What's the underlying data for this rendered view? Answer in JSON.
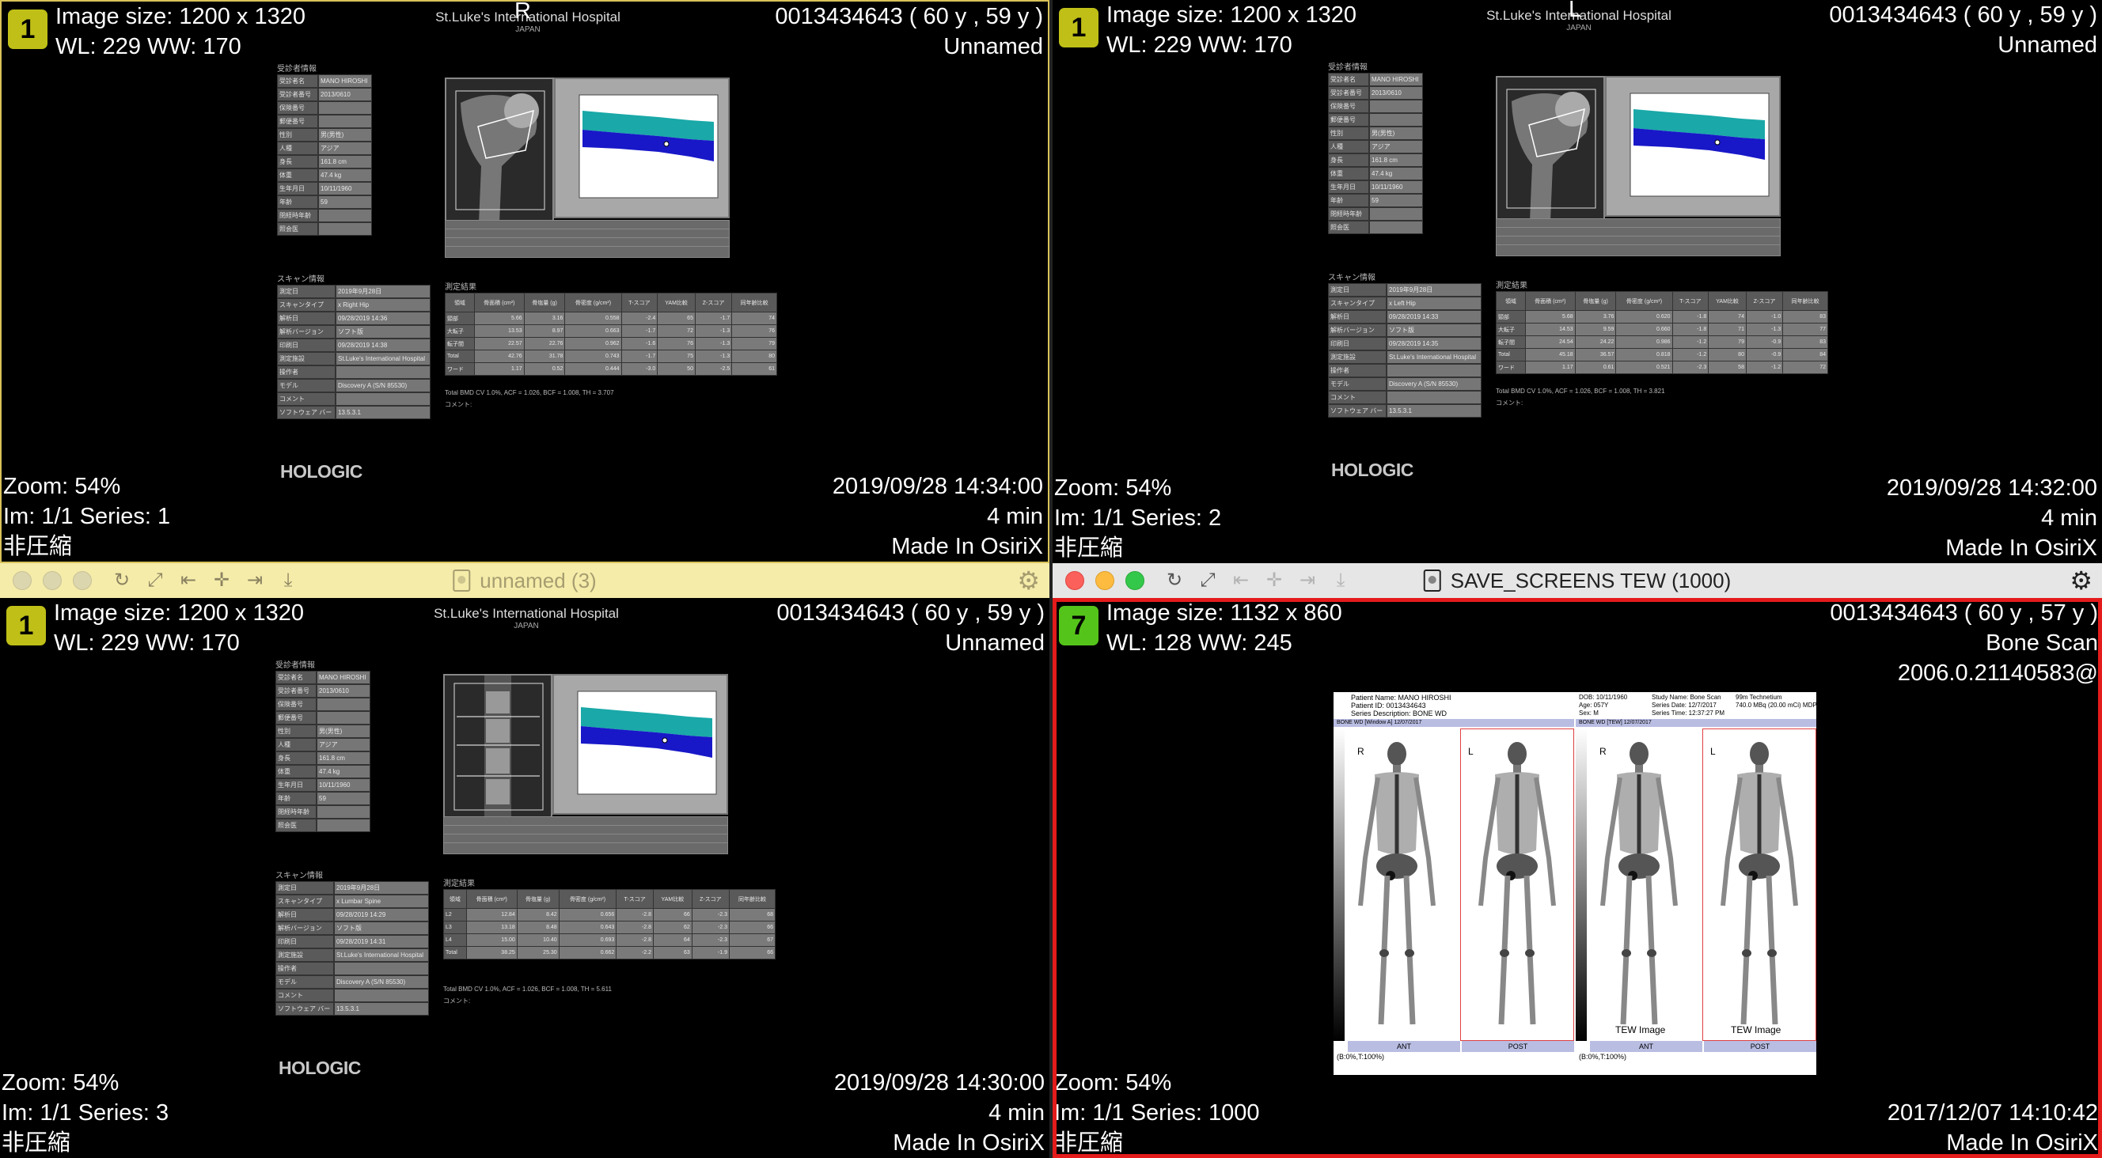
{
  "viewers": [
    {
      "badge": "1",
      "orient_left": "R",
      "orient_right": "",
      "info_tl": [
        "Image size: 1200 x 1320",
        "WL: 229 WW: 170"
      ],
      "info_tr": [
        "0013434643 (  60 y ,  59 y )",
        "Unnamed"
      ],
      "info_bl": [
        "Zoom: 54%",
        "Im: 1/1  Series:  1",
        "非圧縮"
      ],
      "info_br": [
        "2019/09/28 14:34:00",
        "4 min",
        "Made In OsiriX"
      ],
      "report": {
        "hospital": "St.Luke's International Hospital",
        "country": "JAPAN",
        "patient_section": "受診者情報",
        "patient_rows": [
          [
            "受診者名",
            "MANO HIROSHI"
          ],
          [
            "受診者番号",
            "2013/0610"
          ],
          [
            "保険番号",
            ""
          ],
          [
            "郵便番号",
            ""
          ],
          [
            "性別",
            "男(男性)"
          ],
          [
            "人種",
            "アジア"
          ],
          [
            "身長",
            "161.8 cm"
          ],
          [
            "体重",
            "47.4 kg"
          ],
          [
            "生年月日",
            "10/11/1960"
          ],
          [
            "年齢",
            "59"
          ],
          [
            "閉経時年齢",
            ""
          ],
          [
            "照会医",
            ""
          ]
        ],
        "scan_section": "スキャン情報",
        "scan_rows": [
          [
            "測定日",
            "2019年9月28日"
          ],
          [
            "スキャンタイプ",
            "x Right Hip"
          ],
          [
            "解析日",
            "09/28/2019 14:36"
          ],
          [
            "解析バージョン",
            "ソフト版"
          ],
          [
            "印刷日",
            "09/28/2019 14:38"
          ],
          [
            "測定施設",
            "St.Luke's International Hospital"
          ],
          [
            "操作者",
            ""
          ],
          [
            "モデル",
            "Discovery A (S/N 85530)"
          ],
          [
            "コメント",
            ""
          ],
          [
            "ソフトウェア バージョン",
            "13.5.3.1"
          ]
        ],
        "results_label": "測定結果",
        "results_header": [
          "領域",
          "骨面積 (cm²)",
          "骨塩量 (g)",
          "骨密度 (g/cm²)",
          "T-スコア",
          "YAM比較",
          "Z-スコア",
          "同年齢比較"
        ],
        "results_rows": [
          [
            "頸部",
            "5.66",
            "3.16",
            "0.558",
            "-2.4",
            "65",
            "-1.7",
            "74"
          ],
          [
            "大転子",
            "13.53",
            "8.97",
            "0.663",
            "-1.7",
            "72",
            "-1.3",
            "76"
          ],
          [
            "転子間",
            "22.57",
            "22.76",
            "0.962",
            "-1.6",
            "76",
            "-1.3",
            "79"
          ],
          [
            "Total",
            "42.76",
            "31.78",
            "0.743",
            "-1.7",
            "75",
            "-1.3",
            "80"
          ],
          [
            "ワード",
            "1.17",
            "0.52",
            "0.444",
            "-3.0",
            "50",
            "-2.5",
            "61"
          ]
        ],
        "footnote": "Total BMD CV 1.0%, ACF = 1.026, BCF = 1.008, TH = 3.707",
        "comment": "コメント:",
        "brand": "HOLOGIC"
      }
    },
    {
      "badge": "1",
      "orient_left": "",
      "orient_right": "L",
      "info_tl": [
        "Image size: 1200 x 1320",
        "WL: 229 WW: 170"
      ],
      "info_tr": [
        "0013434643 (  60 y ,  59 y )",
        "Unnamed"
      ],
      "info_bl": [
        "Zoom: 54%",
        "Im: 1/1  Series:  2",
        "非圧縮"
      ],
      "info_br": [
        "2019/09/28 14:32:00",
        "4 min",
        "Made In OsiriX"
      ],
      "report": {
        "hospital": "St.Luke's International Hospital",
        "country": "JAPAN",
        "patient_section": "受診者情報",
        "patient_rows": [
          [
            "受診者名",
            "MANO HIROSHI"
          ],
          [
            "受診者番号",
            "2013/0610"
          ],
          [
            "保険番号",
            ""
          ],
          [
            "郵便番号",
            ""
          ],
          [
            "性別",
            "男(男性)"
          ],
          [
            "人種",
            "アジア"
          ],
          [
            "身長",
            "161.8 cm"
          ],
          [
            "体重",
            "47.4 kg"
          ],
          [
            "生年月日",
            "10/11/1960"
          ],
          [
            "年齢",
            "59"
          ],
          [
            "閉経時年齢",
            ""
          ],
          [
            "照会医",
            ""
          ]
        ],
        "scan_section": "スキャン情報",
        "scan_rows": [
          [
            "測定日",
            "2019年9月28日"
          ],
          [
            "スキャンタイプ",
            "x Left Hip"
          ],
          [
            "解析日",
            "09/28/2019 14:33"
          ],
          [
            "解析バージョン",
            "ソフト版"
          ],
          [
            "印刷日",
            "09/28/2019 14:35"
          ],
          [
            "測定施設",
            "St.Luke's International Hospital"
          ],
          [
            "操作者",
            ""
          ],
          [
            "モデル",
            "Discovery A (S/N 85530)"
          ],
          [
            "コメント",
            ""
          ],
          [
            "ソフトウェア バージョン",
            "13.5.3.1"
          ]
        ],
        "results_label": "測定結果",
        "results_header": [
          "領域",
          "骨面積 (cm²)",
          "骨塩量 (g)",
          "骨密度 (g/cm²)",
          "T-スコア",
          "YAM比較",
          "Z-スコア",
          "同年齢比較"
        ],
        "results_rows": [
          [
            "頸部",
            "5.68",
            "3.76",
            "0.620",
            "-1.8",
            "74",
            "-1.0",
            "83"
          ],
          [
            "大転子",
            "14.53",
            "9.59",
            "0.660",
            "-1.8",
            "71",
            "-1.3",
            "77"
          ],
          [
            "転子間",
            "24.54",
            "24.22",
            "0.986",
            "-1.2",
            "79",
            "-0.9",
            "83"
          ],
          [
            "Total",
            "45.18",
            "36.57",
            "0.818",
            "-1.2",
            "80",
            "-0.9",
            "84"
          ],
          [
            "ワード",
            "1.17",
            "0.61",
            "0.521",
            "-2.3",
            "58",
            "-1.2",
            "72"
          ]
        ],
        "footnote": "Total BMD CV 1.0%, ACF = 1.026, BCF = 1.008, TH = 3.821",
        "comment": "コメント:",
        "brand": "HOLOGIC"
      }
    },
    {
      "badge": "1",
      "orient_left": "",
      "orient_right": "",
      "info_tl": [
        "Image size: 1200 x 1320",
        "WL: 229 WW: 170"
      ],
      "info_tr": [
        "0013434643 (  60 y ,  59 y )",
        "Unnamed"
      ],
      "info_bl": [
        "Zoom: 54%",
        "Im: 1/1  Series:  3",
        "非圧縮"
      ],
      "info_br": [
        "2019/09/28 14:30:00",
        "4 min",
        "Made In OsiriX"
      ],
      "report": {
        "hospital": "St.Luke's International Hospital",
        "country": "JAPAN",
        "patient_section": "受診者情報",
        "patient_rows": [
          [
            "受診者名",
            "MANO HIROSHI"
          ],
          [
            "受診者番号",
            "2013/0610"
          ],
          [
            "保険番号",
            ""
          ],
          [
            "郵便番号",
            ""
          ],
          [
            "性別",
            "男(男性)"
          ],
          [
            "人種",
            "アジア"
          ],
          [
            "身長",
            "161.8 cm"
          ],
          [
            "体重",
            "47.4 kg"
          ],
          [
            "生年月日",
            "10/11/1960"
          ],
          [
            "年齢",
            "59"
          ],
          [
            "閉経時年齢",
            ""
          ],
          [
            "照会医",
            ""
          ]
        ],
        "scan_section": "スキャン情報",
        "scan_rows": [
          [
            "測定日",
            "2019年9月28日"
          ],
          [
            "スキャンタイプ",
            "x Lumbar Spine"
          ],
          [
            "解析日",
            "09/28/2019 14:29"
          ],
          [
            "解析バージョン",
            "ソフト版"
          ],
          [
            "印刷日",
            "09/28/2019 14:31"
          ],
          [
            "測定施設",
            "St.Luke's International Hospital"
          ],
          [
            "操作者",
            ""
          ],
          [
            "モデル",
            "Discovery A (S/N 85530)"
          ],
          [
            "コメント",
            ""
          ],
          [
            "ソフトウェア バージョン",
            "13.5.3.1"
          ]
        ],
        "results_label": "測定結果",
        "results_header": [
          "領域",
          "骨面積 (cm²)",
          "骨塩量 (g)",
          "骨密度 (g/cm²)",
          "T-スコア",
          "YAM比較",
          "Z-スコア",
          "同年齢比較"
        ],
        "results_rows": [
          [
            "L2",
            "12.84",
            "8.42",
            "0.656",
            "-2.8",
            "66",
            "-2.3",
            "68"
          ],
          [
            "L3",
            "13.18",
            "8.48",
            "0.643",
            "-2.8",
            "62",
            "-2.3",
            "66"
          ],
          [
            "L4",
            "15.00",
            "10.40",
            "0.693",
            "-2.8",
            "64",
            "-2.3",
            "67"
          ],
          [
            "Total",
            "38.25",
            "25.30",
            "0.662",
            "-2.2",
            "63",
            "-1.9",
            "66"
          ]
        ],
        "footnote": "Total BMD CV 1.0%, ACF = 1.026, BCF = 1.008, TH = 5.611",
        "comment": "コメント:",
        "brand": "HOLOGIC"
      }
    },
    {
      "badge": "7",
      "orient_left": "",
      "orient_right": "",
      "info_tl": [
        "Image size: 1132 x 860",
        "WL: 128 WW: 245"
      ],
      "info_tr": [
        "0013434643 (  60 y ,  57 y )",
        "Bone Scan",
        "2006.0.21140583@"
      ],
      "info_bl": [
        "Zoom: 54%",
        "Im: 1/1  Series:  1000",
        "非圧縮"
      ],
      "info_br": [
        "2017/12/07 14:10:42",
        "Made In OsiriX"
      ],
      "bone": {
        "hdr_left": [
          "Patient Name: MANO HIROSHI",
          "Patient ID: 0013434643",
          "Series Description: BONE WD"
        ],
        "hdr_mid": [
          "DOB: 10/11/1960",
          "Age: 057Y",
          "Sex: M"
        ],
        "hdr_right": [
          "Study Name: Bone Scan",
          "Series Date: 12/7/2017",
          "Series Time: 12:37:27 PM"
        ],
        "hdr_far": [
          "99m Technetium",
          "740.0 MBq (20.00 mCi) MDP"
        ],
        "bar_left": "BONE WD [Window A] 12/07/2017",
        "bar_right": "BONE WD [TEW] 12/07/2017",
        "R": "R",
        "L": "L",
        "tew": "TEW Image",
        "ant": "ANT",
        "post": "POST",
        "pct": "(B:0%,T:100%)"
      }
    }
  ],
  "titlebars": {
    "left_title": "unnamed (3)",
    "right_title": "SAVE_SCREENS TEW (1000)"
  }
}
